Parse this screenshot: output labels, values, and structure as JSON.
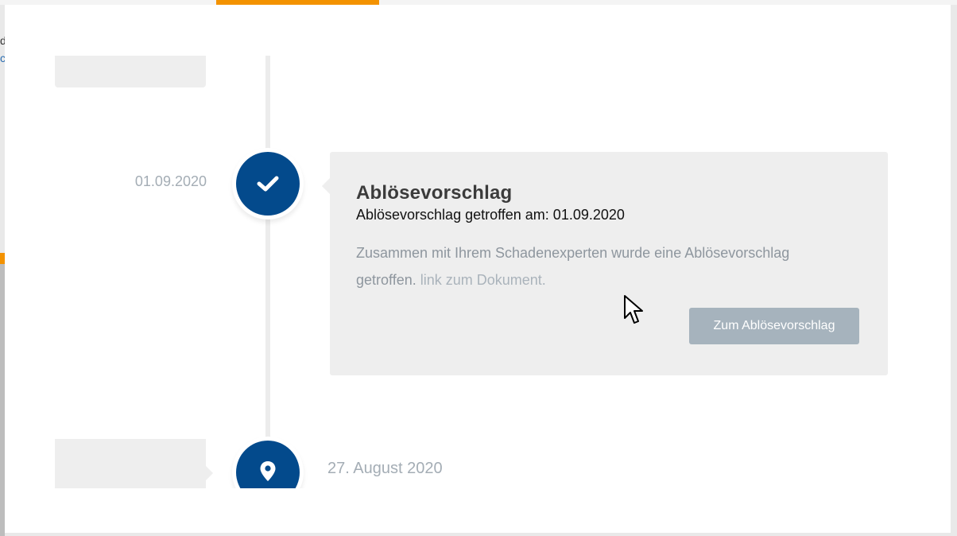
{
  "background": {
    "left_text": "d",
    "left_link": "c"
  },
  "timeline": {
    "active_entry": {
      "date": "01.09.2020",
      "icon": "check-icon",
      "title": "Ablösevorschlag",
      "subtitle": "Ablösevorschlag getroffen am: 01.09.2020",
      "body": "Zusammen mit Ihrem Schadenexperten wurde eine Ablösevorschlag getroffen.",
      "link_label": "link zum Dokument.",
      "button_label": "Zum Ablösevorschlag"
    },
    "next_entry": {
      "date": "27. August 2020",
      "icon": "map-pin-icon"
    }
  },
  "colors": {
    "accent": "#034a8c",
    "brand_orange": "#f39200",
    "card_bg": "#eeeeee",
    "button_bg": "#a6b3bd",
    "muted_text": "#a4adb5"
  }
}
